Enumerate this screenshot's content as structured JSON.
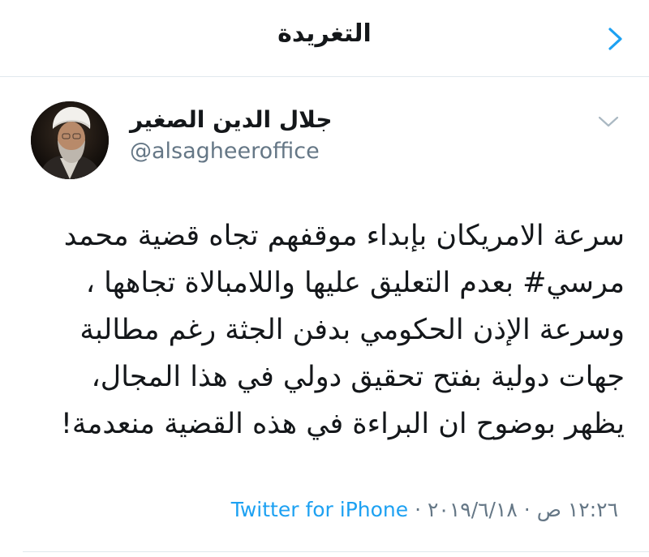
{
  "nav": {
    "title": "التغريدة",
    "back_icon": "chevron-right-icon",
    "accent_color": "#1da1f2"
  },
  "author": {
    "display_name": "جلال الدين الصغير",
    "handle": "@alsagheeroffice",
    "avatar_icon": "avatar",
    "menu_icon": "chevron-down-icon"
  },
  "tweet": {
    "lines": [
      "سرعة الامريكان بإبداء موقفهم تجاه قضية محمد",
      "مرسي# بعدم التعليق عليها واللامبالاة تجاهها ،",
      "وسرعة الإذن الحكومي بدفن الجثة رغم مطالبة",
      "جهات دولية بفتح تحقيق دولي في هذا المجال،",
      "يظهر بوضوح ان البراءة في هذه القضية منعدمة!"
    ]
  },
  "meta": {
    "time": "١٢:٢٦ ص",
    "separator": " · ",
    "date": "٢٠١٩/٦/١٨",
    "source": "Twitter for iPhone"
  }
}
